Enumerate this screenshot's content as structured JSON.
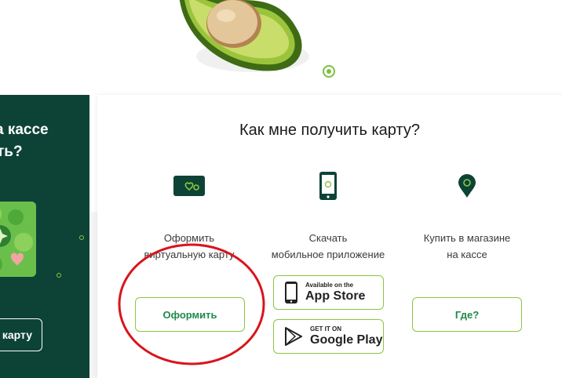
{
  "left_card": {
    "line1": "а кассе",
    "line2": "ть?",
    "button_label": "карту"
  },
  "main": {
    "title": "Как мне получить карту?",
    "columns": [
      {
        "icon": "card-icon",
        "line1": "Оформить",
        "line2": "виртуальную карту",
        "button_label": "Оформить"
      },
      {
        "icon": "phone-icon",
        "line1": "Скачать",
        "line2": "мобильное приложение",
        "app_store": {
          "small": "Available on the",
          "big": "App Store"
        },
        "google_play": {
          "small": "GET IT ON",
          "big": "Google Play"
        }
      },
      {
        "icon": "map-pin-icon",
        "line1": "Купить в магазине",
        "line2": "на кассе",
        "button_label": "Где?"
      }
    ]
  },
  "colors": {
    "dark_green": "#0d4336",
    "accent_green": "#8cc63f",
    "button_text": "#1e8a4a",
    "annotation_red": "#d9141b"
  }
}
